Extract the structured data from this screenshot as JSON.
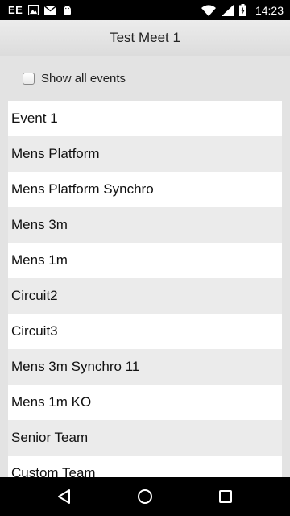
{
  "status_bar": {
    "carrier": "EE",
    "time": "14:23",
    "left_icons": [
      "image-icon",
      "mail-icon",
      "android-icon"
    ],
    "right_icons": [
      "wifi-icon",
      "signal-icon",
      "battery-icon"
    ]
  },
  "header": {
    "title": "Test Meet 1"
  },
  "options": {
    "show_all_label": "Show all events",
    "show_all_checked": false
  },
  "events": [
    "Event 1",
    "Mens Platform",
    "Mens Platform Synchro",
    "Mens 3m",
    "Mens 1m",
    "Circuit2",
    "Circuit3",
    "Mens 3m Synchro 11",
    "Mens 1m KO",
    "Senior Team",
    "Custom Team"
  ],
  "nav_bar": {
    "icons": [
      "back-icon",
      "home-icon",
      "recents-icon"
    ]
  }
}
